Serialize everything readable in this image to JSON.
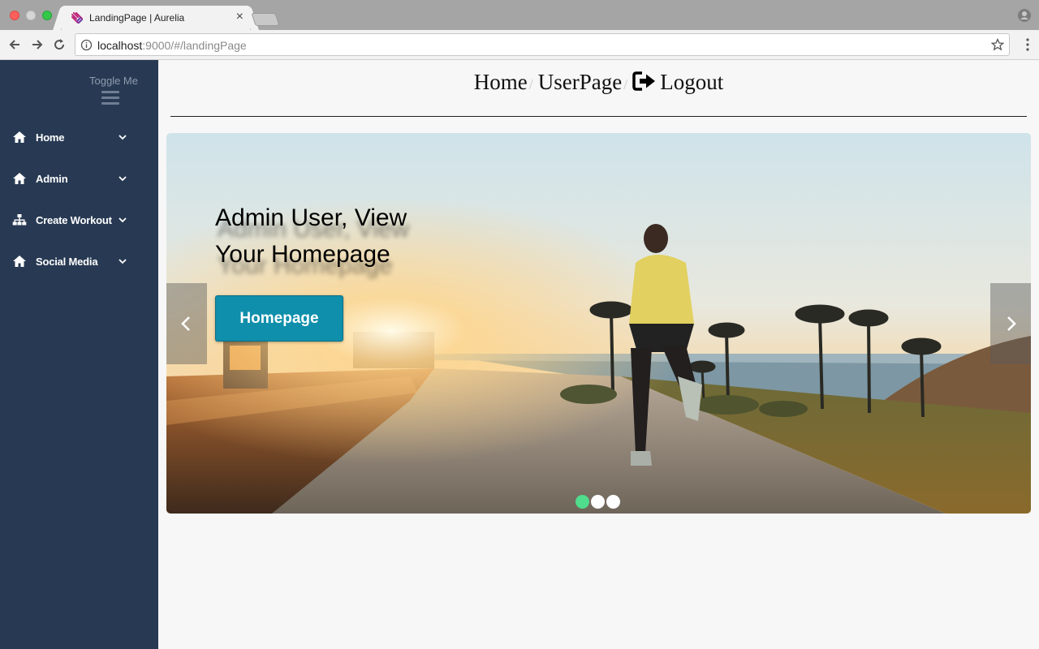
{
  "browser": {
    "tab_title": "LandingPage | Aurelia",
    "tab_close": "×",
    "url_host": "localhost",
    "url_rest": ":9000/#/landingPage"
  },
  "sidebar": {
    "toggle_label": "Toggle Me",
    "items": [
      {
        "label": "Home",
        "icon": "home-icon"
      },
      {
        "label": "Admin",
        "icon": "home-icon"
      },
      {
        "label": "Create Workout",
        "icon": "sitemap-icon"
      },
      {
        "label": "Social Media",
        "icon": "home-icon"
      }
    ]
  },
  "breadcrumb": {
    "home": "Home",
    "userpage": "UserPage",
    "logout": "Logout",
    "separator": "/"
  },
  "carousel": {
    "caption": "Admin User, View Your Homepage",
    "button_label": "Homepage",
    "active_index": 0,
    "slide_count": 3,
    "indicator_active_color": "#4fdc8c"
  },
  "colors": {
    "sidebar_bg": "#283a53",
    "button_bg": "#0f8fab"
  }
}
